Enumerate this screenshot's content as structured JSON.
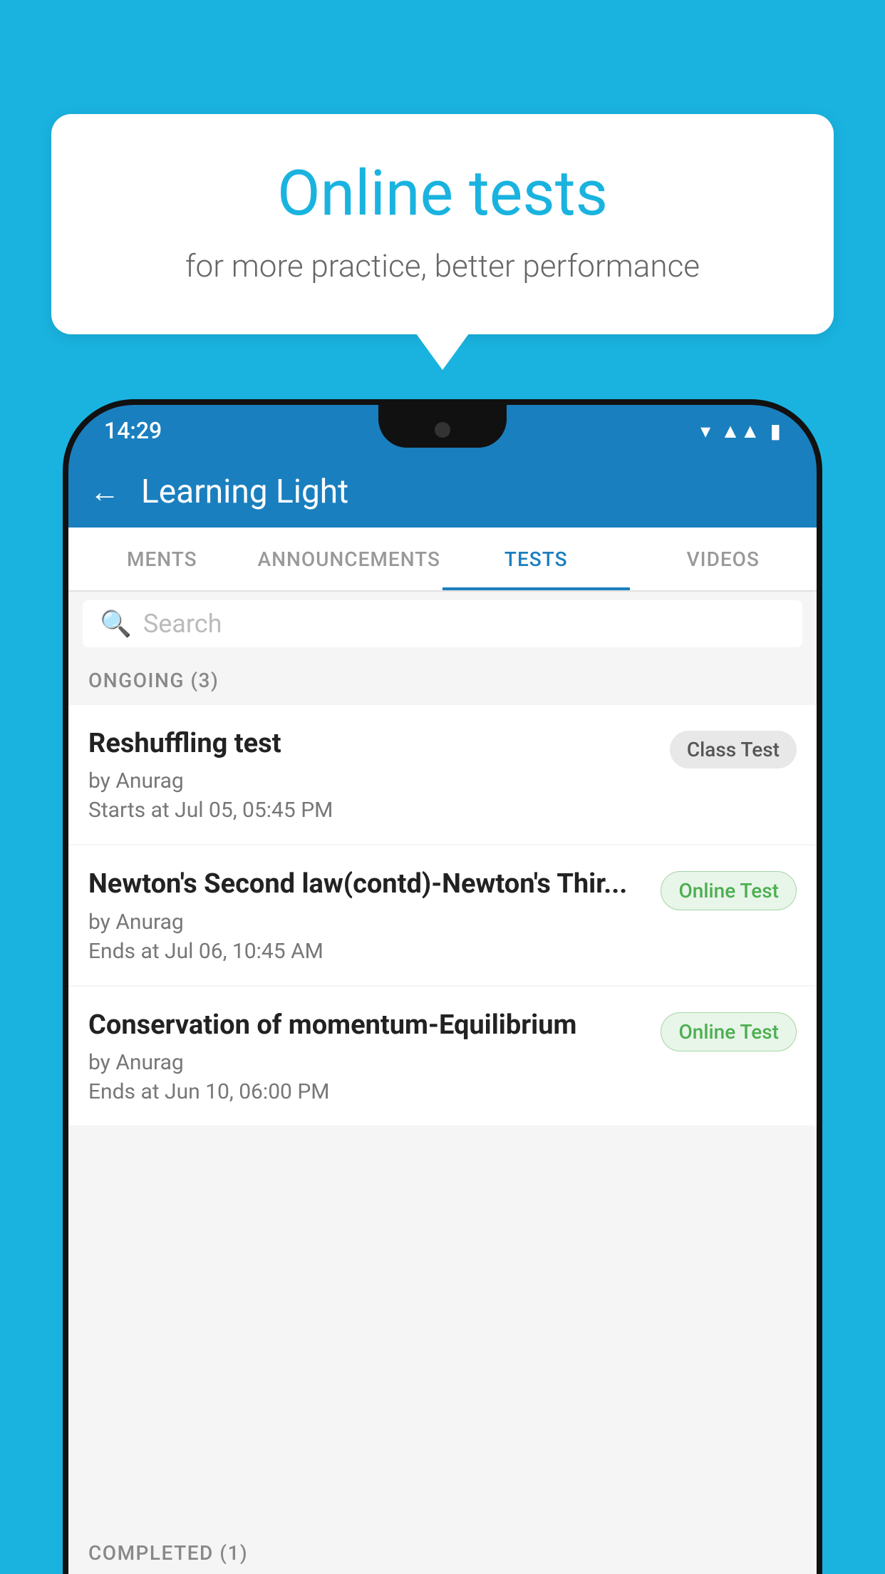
{
  "background": {
    "color": "#1ab3e0"
  },
  "speech_bubble": {
    "title": "Online tests",
    "subtitle": "for more practice, better performance"
  },
  "phone": {
    "status_bar": {
      "time": "14:29",
      "icons": [
        "wifi",
        "signal",
        "battery"
      ]
    },
    "header": {
      "back_label": "←",
      "title": "Learning Light"
    },
    "tabs": [
      {
        "label": "MENTS",
        "active": false
      },
      {
        "label": "ANNOUNCEMENTS",
        "active": false
      },
      {
        "label": "TESTS",
        "active": true
      },
      {
        "label": "VIDEOS",
        "active": false
      }
    ],
    "search": {
      "placeholder": "Search"
    },
    "sections": [
      {
        "header": "ONGOING (3)",
        "tests": [
          {
            "title": "Reshuffling test",
            "by": "by Anurag",
            "date": "Starts at  Jul 05, 05:45 PM",
            "badge": "Class Test",
            "badge_type": "class"
          },
          {
            "title": "Newton's Second law(contd)-Newton's Thir...",
            "by": "by Anurag",
            "date": "Ends at  Jul 06, 10:45 AM",
            "badge": "Online Test",
            "badge_type": "online"
          },
          {
            "title": "Conservation of momentum-Equilibrium",
            "by": "by Anurag",
            "date": "Ends at  Jun 10, 06:00 PM",
            "badge": "Online Test",
            "badge_type": "online"
          }
        ]
      }
    ],
    "completed_header": "COMPLETED (1)"
  }
}
